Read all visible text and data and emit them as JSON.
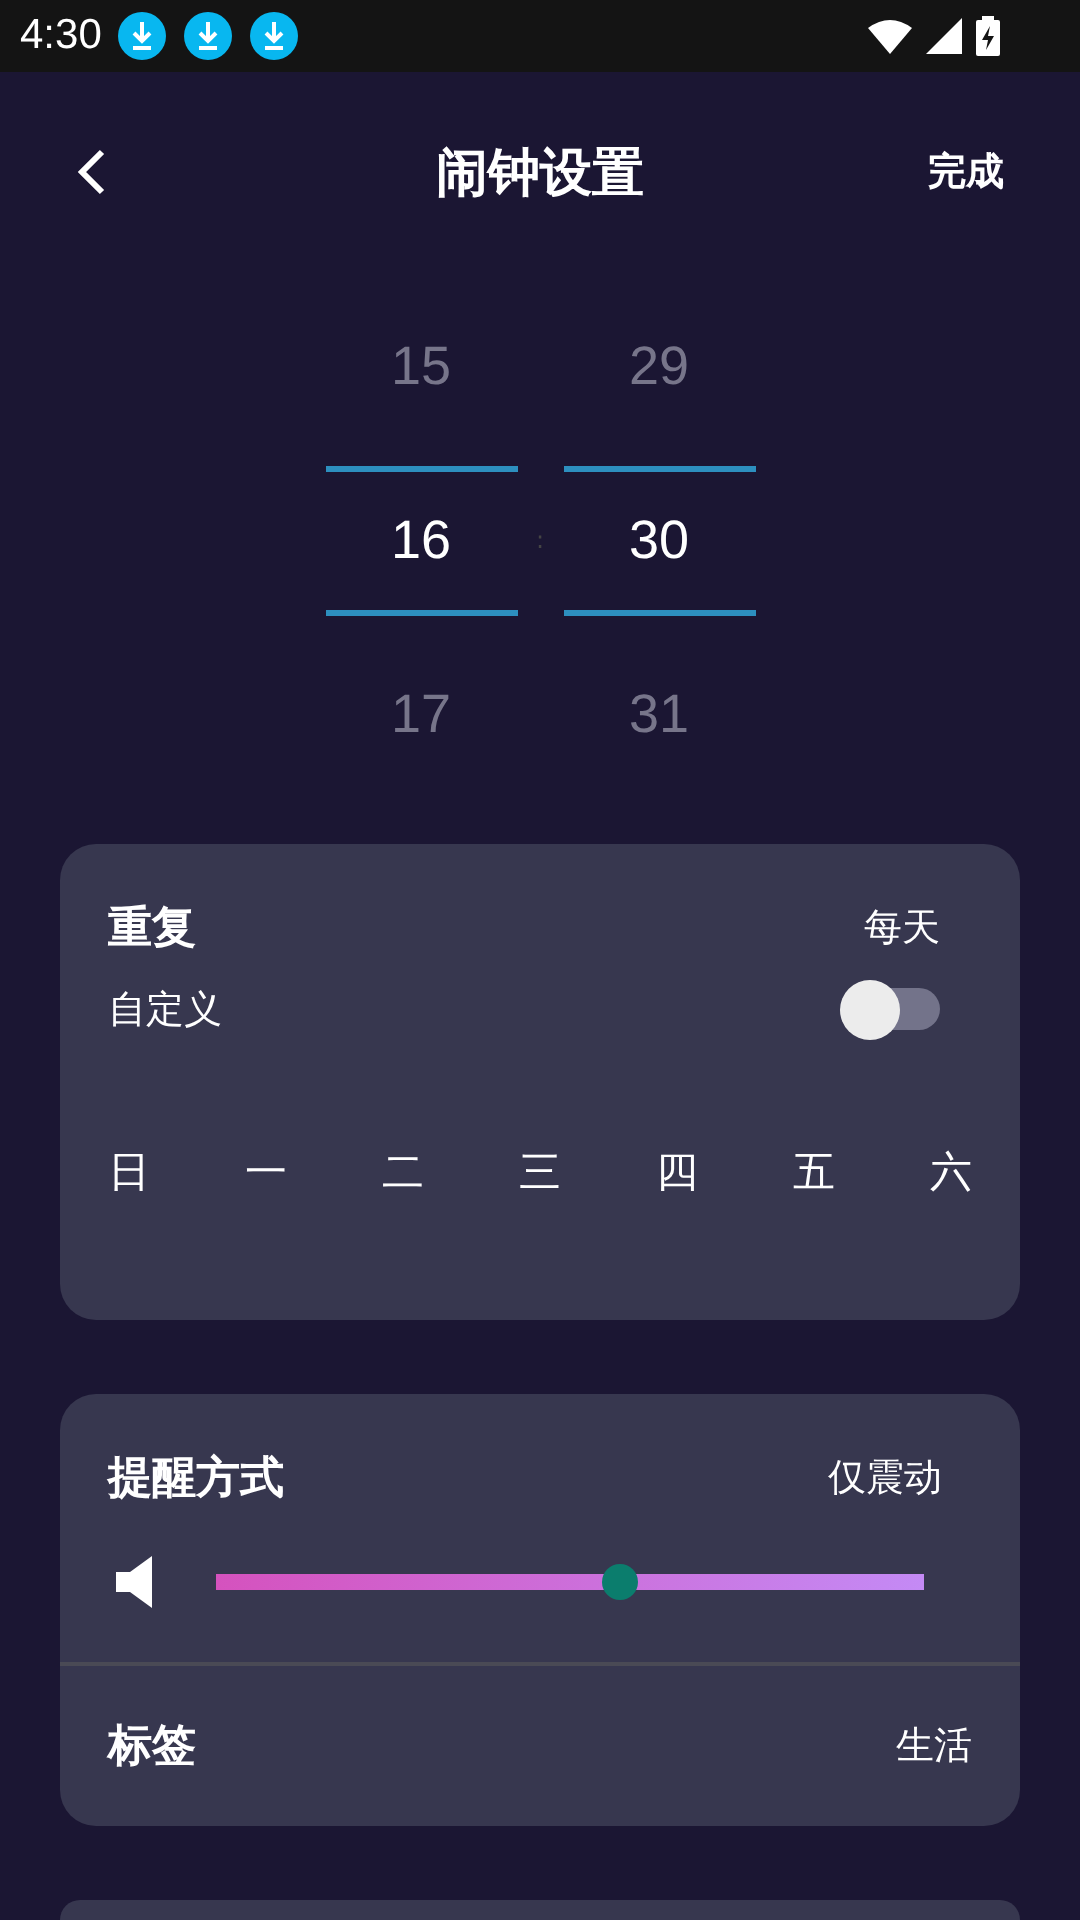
{
  "status_bar": {
    "time": "4:30",
    "notifications": [
      {
        "kind": "download"
      },
      {
        "kind": "download"
      },
      {
        "kind": "download"
      }
    ]
  },
  "header": {
    "title": "闹钟设置",
    "done": "完成"
  },
  "picker": {
    "columns": [
      {
        "items": [
          {
            "text": "15",
            "selected": false
          },
          {
            "text": "16",
            "selected": true
          },
          {
            "text": "17",
            "selected": false
          }
        ]
      },
      {
        "items": [
          {
            "text": "29",
            "selected": false
          },
          {
            "text": "30",
            "selected": true
          },
          {
            "text": "31",
            "selected": false
          }
        ]
      }
    ],
    "separator": ":"
  },
  "repeat": {
    "title": "重复",
    "value": "每天",
    "custom": {
      "label": "自定义",
      "on": false
    },
    "days": [
      "日",
      "一",
      "二",
      "三",
      "四",
      "五",
      "六"
    ]
  },
  "reminder": {
    "title": "提醒方式",
    "value": "仅震动",
    "volume": {
      "level": 0.57
    }
  },
  "tag": {
    "title": "标签",
    "value": "生活"
  }
}
